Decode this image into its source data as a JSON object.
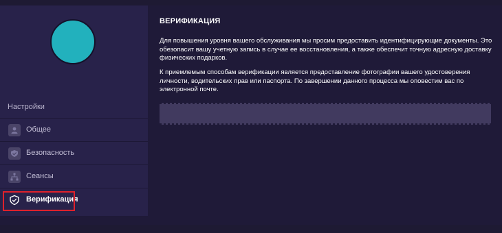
{
  "sidebar": {
    "section_title": "Настройки",
    "items": [
      {
        "label": "Общее",
        "icon": "user-icon"
      },
      {
        "label": "Безопасность",
        "icon": "shield-check-icon"
      },
      {
        "label": "Сеансы",
        "icon": "network-icon"
      },
      {
        "label": "Верификация",
        "icon": "shield-icon",
        "active": true
      }
    ],
    "avatar_color": "#22b1bd"
  },
  "main": {
    "title": "ВЕРИФИКАЦИЯ",
    "paragraph1": "Для повышения уровня вашего обслуживания мы просим предоставить идентифицирующие документы. Это обезопасит вашу учетную запись в случае ее восстановления, а также обеспечит точную адресную доставку физических подарков.",
    "paragraph2": "К приемлемым способам верификации является предоставление фотографии вашего удостоверения личности, водительских прав или паспорта. По завершении данного процесса мы оповестим вас по электронной почте."
  },
  "colors": {
    "background": "#1f1a38",
    "sidebar": "#28224a",
    "highlight": "#e0212b",
    "upload_bar": "#413a5f"
  }
}
